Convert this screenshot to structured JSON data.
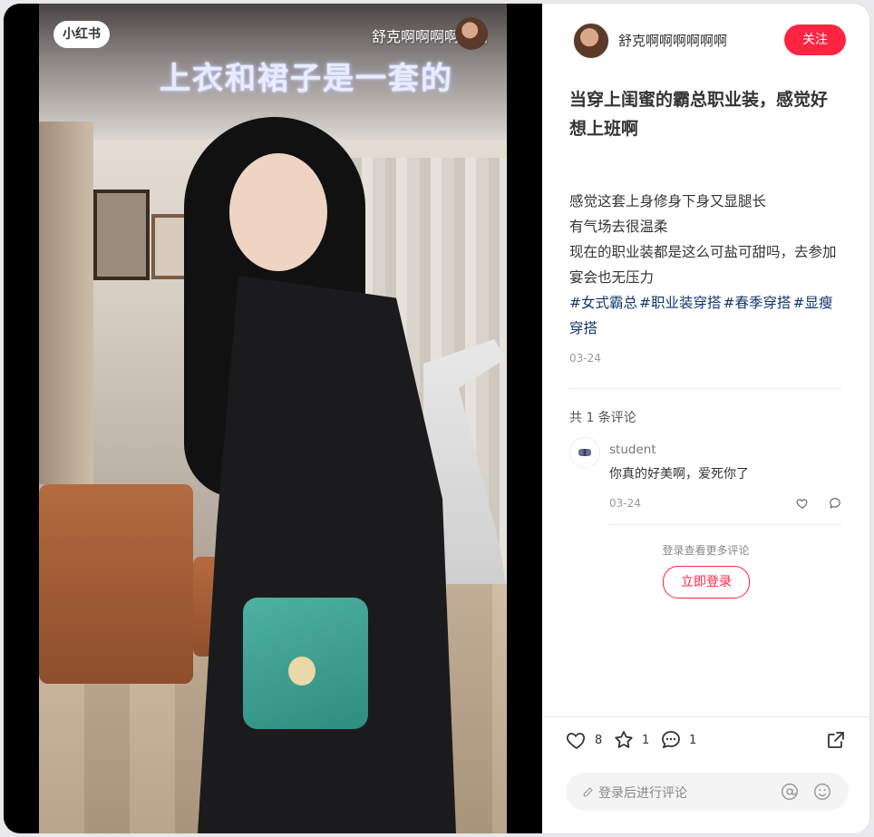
{
  "media": {
    "logo": "小红书",
    "author": "舒克啊啊啊啊啊啊",
    "overlay_caption": "上衣和裙子是一套的"
  },
  "author": {
    "name": "舒克啊啊啊啊啊啊",
    "follow_label": "关注"
  },
  "note": {
    "title": "当穿上闺蜜的霸总职业装，感觉好想上班啊",
    "description": [
      "感觉这套上身修身下身又显腿长",
      "有气场去很温柔",
      "现在的职业装都是这么可盐可甜吗，去参加宴会也无压力"
    ],
    "tags": [
      "#女式霸总",
      "#职业装穿搭",
      "#春季穿搭",
      "#显瘦穿搭"
    ],
    "date": "03-24"
  },
  "comments": {
    "count_label": "共 1 条评论",
    "items": [
      {
        "user": "student",
        "text": "你真的好美啊，爱死你了",
        "date": "03-24"
      }
    ],
    "login_hint": "登录查看更多评论",
    "login_button": "立即登录"
  },
  "actions": {
    "likes": "8",
    "collects": "1",
    "comments": "1"
  },
  "comment_box": {
    "placeholder": "登录后进行评论"
  },
  "colors": {
    "brand": "#ff2442",
    "tag": "#13386c"
  }
}
